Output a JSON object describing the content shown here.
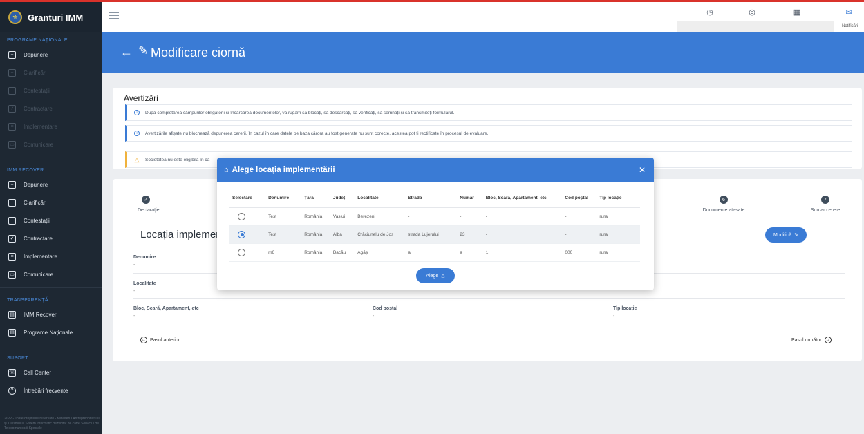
{
  "app": {
    "brand": "Granturi IMM"
  },
  "sidebar": {
    "sections": [
      {
        "title": "PROGRAME NAȚIONALE",
        "items": [
          {
            "label": "Depunere",
            "icon": "plus-square-icon",
            "dim": false
          },
          {
            "label": "Clarificări",
            "icon": "plus-square-icon",
            "dim": true
          },
          {
            "label": "Contestații",
            "icon": "square-icon",
            "dim": true
          },
          {
            "label": "Contractare",
            "icon": "check-square-icon",
            "dim": true
          },
          {
            "label": "Implementare",
            "icon": "doc-icon",
            "dim": true
          },
          {
            "label": "Comunicare",
            "icon": "chat-icon",
            "dim": true
          }
        ]
      },
      {
        "title": "IMM RECOVER",
        "items": [
          {
            "label": "Depunere",
            "icon": "plus-square-icon",
            "dim": false
          },
          {
            "label": "Clarificări",
            "icon": "plus-square-icon",
            "dim": false
          },
          {
            "label": "Contestații",
            "icon": "square-icon",
            "dim": false
          },
          {
            "label": "Contractare",
            "icon": "check-square-icon",
            "dim": false
          },
          {
            "label": "Implementare",
            "icon": "doc-icon",
            "dim": false
          },
          {
            "label": "Comunicare",
            "icon": "chat-icon",
            "dim": false
          }
        ]
      },
      {
        "title": "TRANSPARENȚĂ",
        "items": [
          {
            "label": "IMM Recover",
            "icon": "grid-icon",
            "dim": false
          },
          {
            "label": "Programe Naționale",
            "icon": "grid-icon",
            "dim": false
          }
        ]
      },
      {
        "title": "SUPORT",
        "items": [
          {
            "label": "Call Center",
            "icon": "headset-icon",
            "dim": false
          },
          {
            "label": "Întrebări frecvente",
            "icon": "question-icon",
            "dim": false
          }
        ]
      }
    ],
    "footer": "2022 - Toate drepturile rezervate - Ministerul Antreprenoriatului și Turismului. Sistem informatic dezvoltat de către Serviciul de Telecomunicații Speciale"
  },
  "topbar": {
    "notifications_label": "Notificări"
  },
  "header": {
    "back": "←",
    "title": "Modificare ciornă"
  },
  "warnings": {
    "title": "Avertizări",
    "items": [
      {
        "text": "După completarea câmpurilor obligatorii și încărcarea documentelor, vă rugăm să blocați, să descărcați, să verificați, să semnați și să transmiteți formularul.",
        "kind": "info"
      },
      {
        "text": "Avertizările afișate nu blochează depunerea cererii. În cazul în care datele pe baza cărora au fost generate nu sunt corecte, acestea pot fi rectificate în procesul de evaluare.",
        "kind": "info"
      },
      {
        "text": "Societatea nu este eligibilă în ca",
        "kind": "warning"
      }
    ]
  },
  "steps": [
    {
      "num": "✓",
      "label": "Declarație"
    },
    {
      "num": "6",
      "label": "Documente atasate"
    },
    {
      "num": "7",
      "label": "Sumar cerere"
    }
  ],
  "form": {
    "section_title": "Locația implement",
    "modify_button": "Modifică",
    "fields": [
      {
        "label": "Denumire",
        "value": "-"
      },
      {
        "label": "Localitate",
        "value": "-"
      },
      {
        "label": "Bloc, Scară, Apartament, etc",
        "value": "-"
      },
      {
        "label": "Cod poștal",
        "value": "-"
      },
      {
        "label": "Tip locație",
        "value": "-"
      }
    ],
    "prev": "Pasul anterior",
    "next": "Pasul următor"
  },
  "modal": {
    "title": "Alege locația implementării",
    "columns": [
      "Selectare",
      "Denumire",
      "Țară",
      "Județ",
      "Localitate",
      "Stradă",
      "Număr",
      "Bloc, Scară, Apartament, etc",
      "Cod poștal",
      "Tip locație"
    ],
    "rows": [
      {
        "selected": false,
        "cells": [
          "Test",
          "România",
          "Vaslui",
          "Berezeni",
          "-",
          "-",
          "-",
          "-",
          "rural"
        ]
      },
      {
        "selected": true,
        "cells": [
          "Test",
          "România",
          "Alba",
          "Crăciunelu de Jos",
          "strada Lujerului",
          "23",
          "-",
          "-",
          "rural"
        ]
      },
      {
        "selected": false,
        "cells": [
          "m6",
          "România",
          "Bacău",
          "Agăș",
          "a",
          "a",
          "1",
          "000",
          "rural"
        ]
      }
    ],
    "choose_button": "Alege"
  },
  "colors": {
    "primary": "#3a7bd5",
    "sidebar": "#1e2833",
    "warning": "#f0b23c"
  }
}
